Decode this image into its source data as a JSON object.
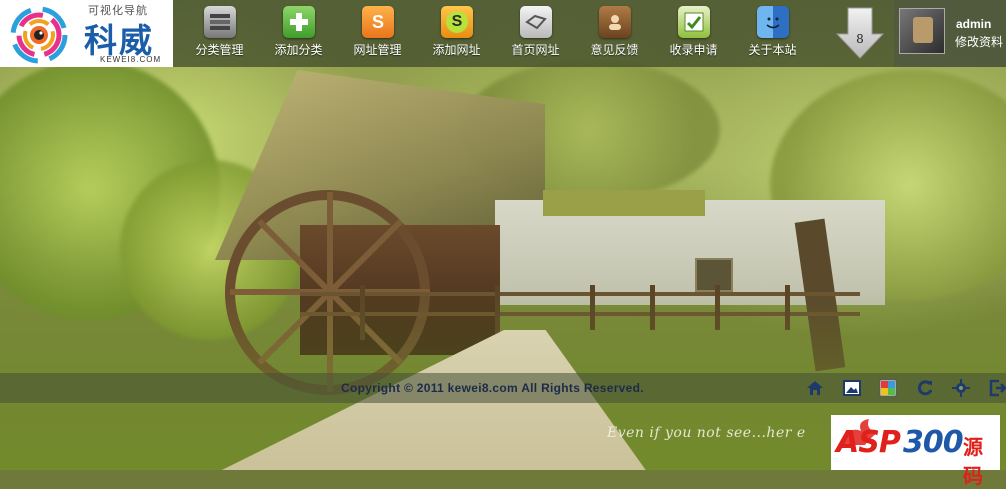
{
  "logo": {
    "tagline": "可视化导航",
    "brand": "科威",
    "domain": "KEWEI8.COM"
  },
  "nav": [
    {
      "label": "分类管理",
      "icon": "category-list-icon",
      "color": "#8e8e8e"
    },
    {
      "label": "添加分类",
      "icon": "add-plus-icon",
      "color": "#5aae3c"
    },
    {
      "label": "网址管理",
      "icon": "s-url-manage-icon",
      "color": "#f08a1f"
    },
    {
      "label": "添加网址",
      "icon": "s-add-url-icon",
      "color": "#f5a51a"
    },
    {
      "label": "首页网址",
      "icon": "home-links-icon",
      "color": "#bdbdbd"
    },
    {
      "label": "意见反馈",
      "icon": "contact-book-icon",
      "color": "#8a5a2e"
    },
    {
      "label": "收录申请",
      "icon": "submit-apply-icon",
      "color": "#8fbf3c"
    },
    {
      "label": "关于本站",
      "icon": "finder-about-icon",
      "color": "#3a82d6"
    }
  ],
  "download": {
    "count": "8",
    "icon": "down-arrow-icon"
  },
  "user": {
    "name": "admin",
    "edit_label": "修改资料"
  },
  "footer": {
    "copyright": "Copyright © 2011 kewei8.com All Rights Reserved.",
    "tools": [
      "home-icon",
      "image-icon",
      "color-palette-icon",
      "refresh-icon",
      "gear-icon",
      "logout-icon"
    ]
  },
  "slogan": "Even if you not see...her e",
  "badge": {
    "asp": "ASP",
    "num": "300",
    "cn": "源码"
  }
}
